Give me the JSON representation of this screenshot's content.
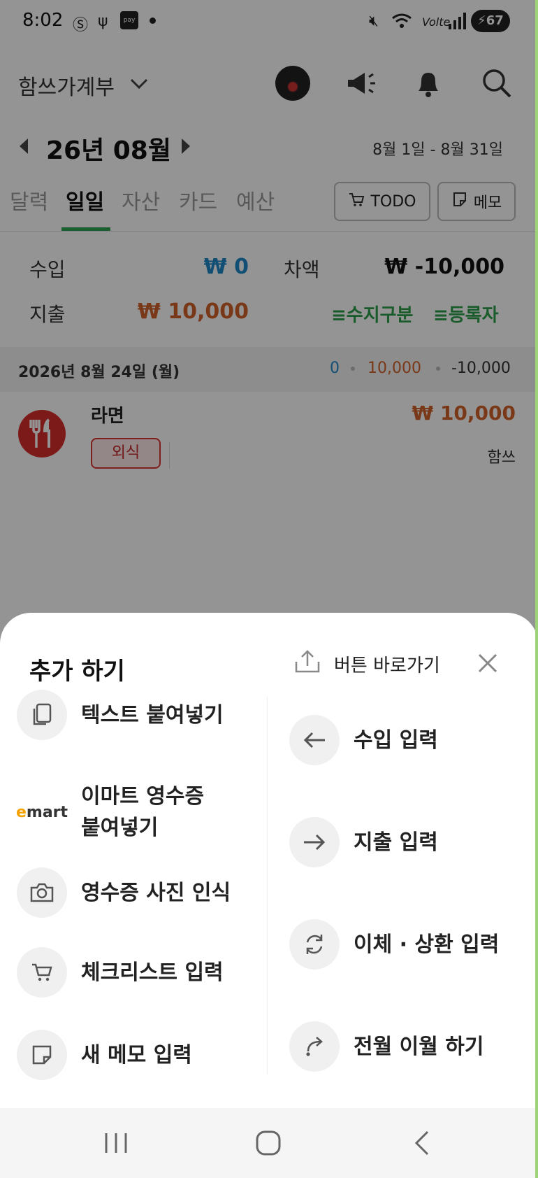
{
  "status": {
    "time": "8:02",
    "pay": "pay",
    "battery": "67"
  },
  "header": {
    "app_title": "함쓰가계부"
  },
  "month": {
    "label": "26년 08월",
    "range": "8월 1일 - 8월 31일"
  },
  "tabs": [
    {
      "label": "달력"
    },
    {
      "label": "일일"
    },
    {
      "label": "자산"
    },
    {
      "label": "카드"
    },
    {
      "label": "예산"
    }
  ],
  "tab_buttons": {
    "todo": "TODO",
    "memo": "메모"
  },
  "summary": {
    "income_label": "수입",
    "income_value": "₩ 0",
    "diff_label": "차액",
    "diff_value": "₩ -10,000",
    "expense_label": "지출",
    "expense_value": "₩ 10,000",
    "filter_type": "수지구분",
    "filter_user": "등록자"
  },
  "day": {
    "date": "2026년 8월 24일 (월)",
    "income": "0",
    "expense": "10,000",
    "total": "-10,000"
  },
  "entry": {
    "name": "라면",
    "amount": "₩ 10,000",
    "category": "외식",
    "user": "함쓰"
  },
  "sheet": {
    "title": "추가 하기",
    "shortcut_label": "버튼 바로가기",
    "left_options": [
      {
        "label": "텍스트 붙여넣기"
      },
      {
        "label": "이마트 영수증",
        "label2": "붙여넣기"
      },
      {
        "label": "영수증 사진 인식"
      },
      {
        "label": "체크리스트 입력"
      },
      {
        "label": "새 메모 입력"
      }
    ],
    "right_options": [
      {
        "label": "수입 입력"
      },
      {
        "label": "지출 입력"
      },
      {
        "label": "이체 · 상환 입력"
      },
      {
        "label": "전월 이월 하기"
      }
    ],
    "emart_logo": "emart"
  },
  "colors": {
    "income": "#1e88c8",
    "expense": "#d0622a",
    "accent": "#2e9d4a"
  }
}
